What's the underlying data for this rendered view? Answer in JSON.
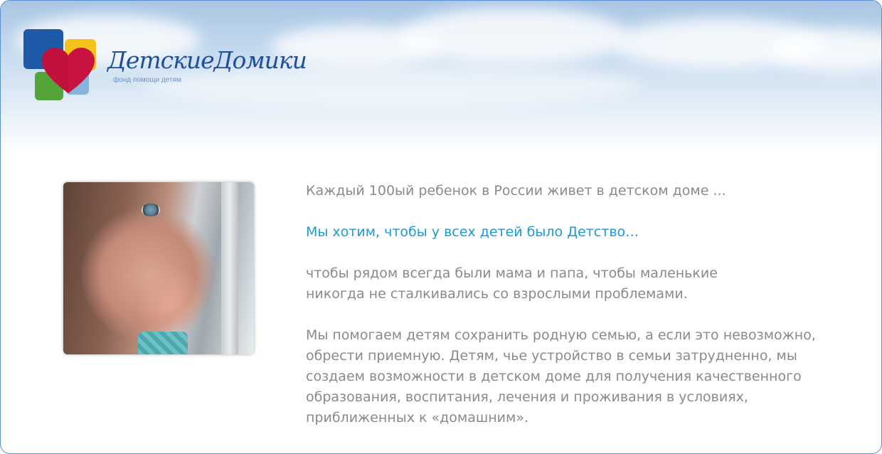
{
  "header": {
    "brand_name": "ДетскиеДомики",
    "tagline": "фонд помощи детям"
  },
  "colors": {
    "accent": "#1d99d6",
    "body_text": "#8a8a8a",
    "brand": "#1e4f98",
    "border": "#5b8fd0"
  },
  "main": {
    "photo_alt": "ребенок у окна",
    "paragraphs": [
      {
        "lines": [
          "Каждый 100ый ребенок в России живет в детском доме ..."
        ],
        "style": "normal"
      },
      {
        "lines": [
          "Мы хотим, чтобы у всех детей было Детство…"
        ],
        "style": "accent"
      },
      {
        "lines": [
          "чтобы рядом всегда были мама и папа, чтобы маленькие",
          "никогда не сталкивались со взрослыми проблемами."
        ],
        "style": "normal"
      },
      {
        "lines": [
          "Мы помогаем детям сохранить родную семью, а если это невозможно,",
          "обрести приемную. Детям, чье устройство в семьи затрудненно, мы",
          "создаем возможности в детском доме для получения качественного",
          "образования, воспитания, лечения и проживания в условиях,",
          "приближенных к «домашним»."
        ],
        "style": "normal"
      }
    ]
  }
}
